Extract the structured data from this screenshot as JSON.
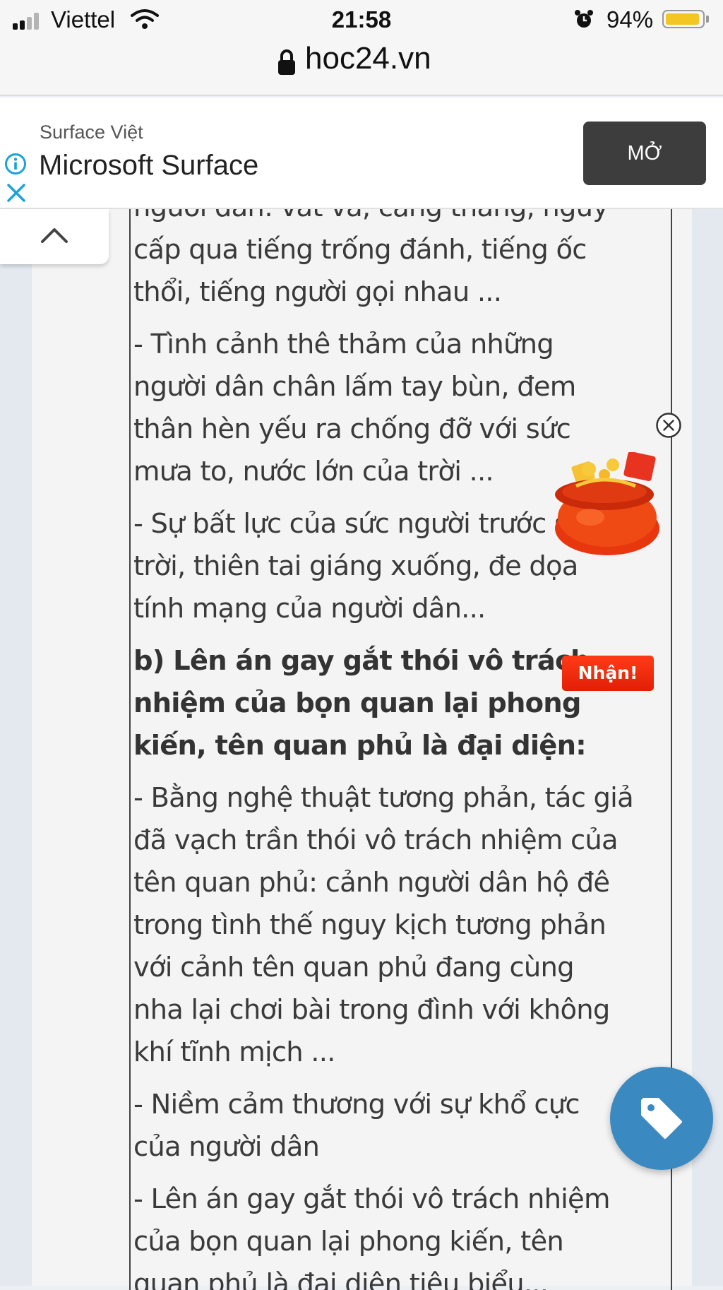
{
  "status_bar": {
    "carrier": "Viettel",
    "time": "21:58",
    "battery_percent": "94%",
    "battery_level": 0.94,
    "icons": [
      "signal-icon",
      "wifi-icon",
      "alarm-icon",
      "battery-icon"
    ]
  },
  "browser": {
    "url": "hoc24.vn",
    "icons": [
      "lock-icon"
    ]
  },
  "ad": {
    "brand": "Surface Việt",
    "title": "Microsoft Surface",
    "button_label": "MỞ",
    "icons": [
      "info-icon",
      "close-icon"
    ]
  },
  "answer": {
    "paragraphs": [
      {
        "lines": [
          "người dân: vất vả, căng thẳng, nguy",
          "cấp qua tiếng trống đánh, tiếng ốc",
          "thổi, tiếng người gọi nhau ..."
        ]
      },
      {
        "lines": [
          "- Tình cảnh thê thảm của những",
          "người dân chân lấm tay bùn, đem",
          "thân hèn yếu ra chống đỡ với sức",
          "mưa to, nước lớn của trời ..."
        ]
      },
      {
        "lines": [
          "- Sự bất lực của sức người trước sức",
          "trời, thiên tai giáng xuống, đe dọa",
          "tính mạng của người dân..."
        ]
      },
      {
        "heading": true,
        "lines": [
          "b) Lên án gay gắt thói vô trách",
          "nhiệm của bọn quan lại phong",
          "kiến, tên quan phủ là đại diện:"
        ]
      },
      {
        "lines": [
          "- Bằng nghệ thuật tương phản, tác giả",
          "đã vạch trần thói vô trách nhiệm của",
          "tên quan phủ: cảnh người dân hộ đê",
          "trong tình thế nguy kịch tương phản",
          "với cảnh tên quan phủ đang cùng",
          "nha lại chơi bài trong đình với không",
          "khí tĩnh mịch ..."
        ]
      },
      {
        "lines": [
          "- Niềm cảm thương với sự khổ cực",
          "của người dân"
        ]
      },
      {
        "lines": [
          "- Lên án gay gắt thói vô trách nhiệm",
          "của bọn quan lại phong kiến, tên",
          "quan phủ là đại diện tiêu biểu..."
        ]
      }
    ]
  },
  "promo": {
    "label": "Nhận!",
    "colors": {
      "label_bg": "#e8240a",
      "bag": "#f04a14"
    },
    "icons": [
      "close-circle-icon",
      "gift-bag-icon"
    ]
  },
  "collapse_tab": {
    "icons": [
      "chevron-up-icon"
    ]
  },
  "fab": {
    "icons": [
      "tag-icon"
    ],
    "color": "#3a89c0"
  }
}
